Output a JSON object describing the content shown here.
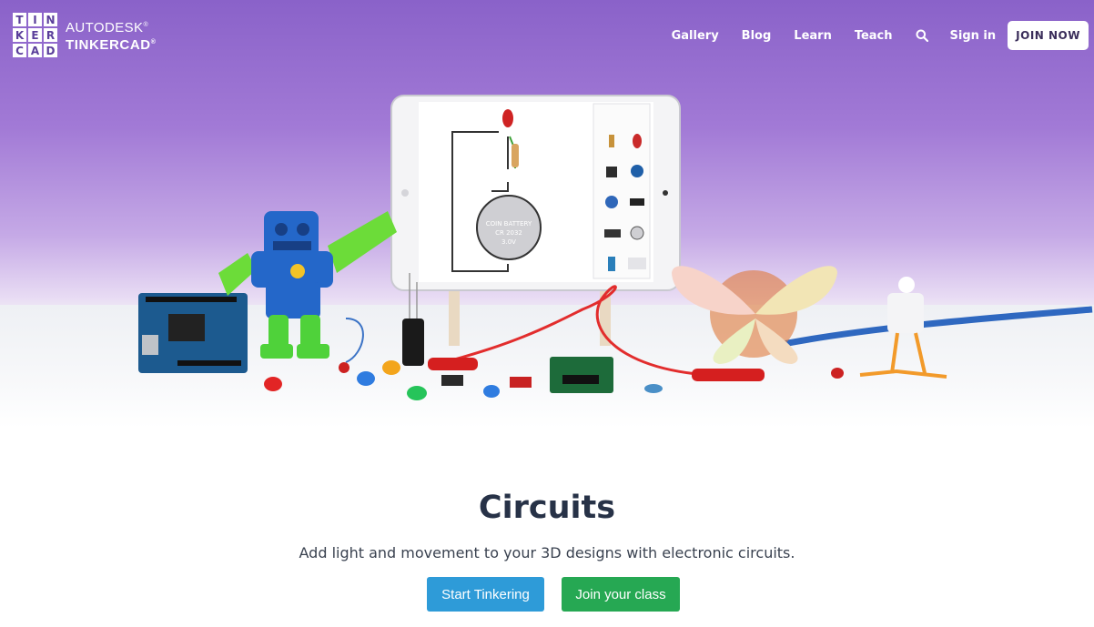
{
  "brand": {
    "logo_letters": [
      "T",
      "I",
      "N",
      "K",
      "E",
      "R",
      "C",
      "A",
      "D"
    ],
    "line1": "AUTODESK",
    "line2": "TINKERCAD",
    "trademark": "®"
  },
  "nav": {
    "links": [
      "Gallery",
      "Blog",
      "Learn",
      "Teach"
    ],
    "sign_in": "Sign in",
    "join": "JOIN NOW",
    "search_icon": "search-icon"
  },
  "hero": {
    "battery_label_1": "COIN BATTERY",
    "battery_label_2": "CR 2032",
    "battery_label_3": "3.0V"
  },
  "main": {
    "title": "Circuits",
    "subtitle": "Add light and movement to your 3D designs with electronic circuits.",
    "start_button": "Start Tinkering",
    "class_button": "Join your class"
  },
  "colors": {
    "hero_top": "#8a62c9",
    "start_button": "#2e9bd8",
    "class_button": "#26a853",
    "title": "#273247"
  }
}
